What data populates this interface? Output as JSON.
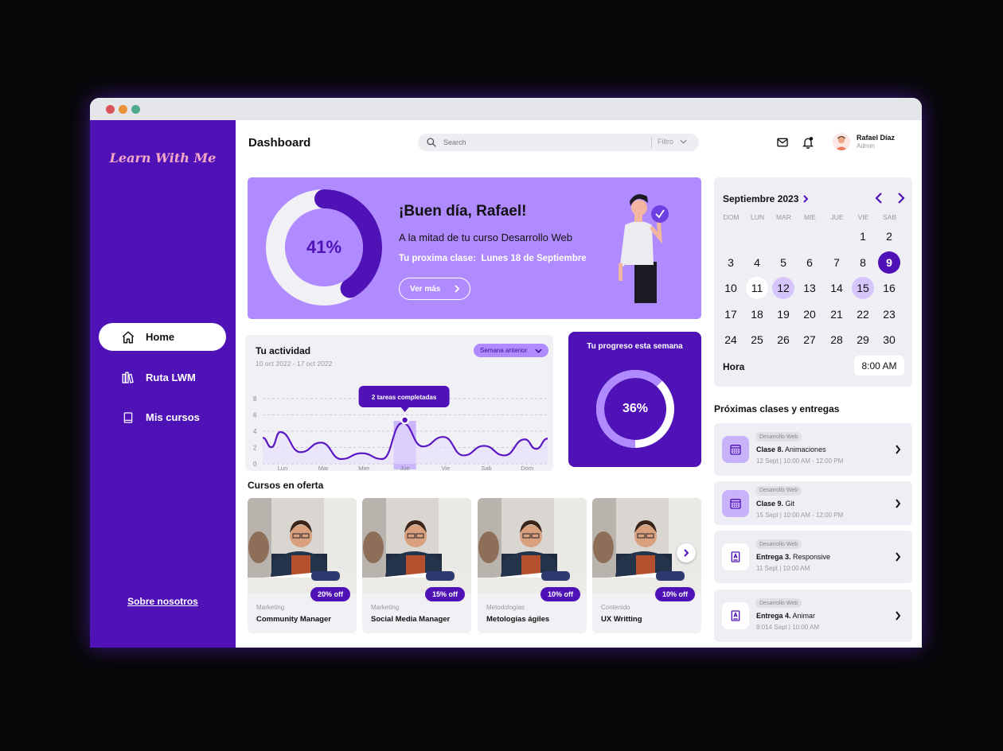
{
  "brand": "Learn With Me",
  "sidebar": {
    "items": [
      {
        "label": "Home",
        "icon": "home-icon",
        "active": true
      },
      {
        "label": "Ruta LWM",
        "icon": "library-icon",
        "active": false
      },
      {
        "label": "Mis cursos",
        "icon": "book-icon",
        "active": false
      }
    ],
    "about": "Sobre nosotros"
  },
  "header": {
    "title": "Dashboard",
    "search_placeholder": "Search",
    "filter_label": "Filtro",
    "user_name": "Rafael Díaz",
    "user_role": "Admin"
  },
  "banner": {
    "progress_pct": 41,
    "progress_label": "41%",
    "greeting": "¡Buen día, Rafael!",
    "subtitle": "A la mitad de tu curso Desarrollo Web",
    "next_class_label": "Tu proxima clase:",
    "next_class_date": "Lunes 18 de Septiembre",
    "cta": "Ver más"
  },
  "activity": {
    "title": "Tu actividad",
    "range": "10 oct 2022 - 17 oct 2022",
    "week_select": "Semana anterior",
    "tooltip": "2 tareas completadas",
    "y_ticks": [
      "8",
      "6",
      "4",
      "2",
      "0"
    ],
    "days": [
      "Lun",
      "Mar",
      "Mier",
      "Jue",
      "Vie",
      "Sab",
      "Dom"
    ]
  },
  "chart_data": {
    "type": "line",
    "title": "Tu actividad",
    "categories": [
      "Lun",
      "Mar",
      "Mier",
      "Jue",
      "Vie",
      "Sab",
      "Dom"
    ],
    "values": [
      3.9,
      2.6,
      1.3,
      5.0,
      3.3,
      2.2,
      3.0
    ],
    "ylim": [
      0,
      8
    ],
    "highlight": {
      "category": "Jue",
      "value": 5,
      "label": "2 tareas completadas"
    },
    "grid": true
  },
  "weekly_progress": {
    "title": "Tu progreso esta semana",
    "pct": 36,
    "label": "36%"
  },
  "offers": {
    "title": "Cursos en oferta",
    "courses": [
      {
        "discount": "20% off",
        "category": "Marketing",
        "name": "Community Manager"
      },
      {
        "discount": "15% off",
        "category": "Marketing",
        "name": "Social Media Manager"
      },
      {
        "discount": "10% off",
        "category": "Metodologías",
        "name": "Metologías ágiles"
      },
      {
        "discount": "10% off",
        "category": "Contenido",
        "name": "UX Writting"
      }
    ]
  },
  "calendar": {
    "month": "Septiembre 2023",
    "weekdays": [
      "DOM",
      "LUN",
      "MAR",
      "MIE",
      "JUE",
      "VIE",
      "SAB"
    ],
    "first_weekday": 5,
    "days_in_month": 30,
    "selected_day": 9,
    "highlighted_days": [
      12,
      15
    ],
    "white_days": [
      11
    ],
    "hora_label": "Hora",
    "hora_value": "8:00 AM"
  },
  "upcoming": {
    "title": "Próximas clases y entregas",
    "items": [
      {
        "tag": "Desarrollo Web",
        "kind": "Clase 8.",
        "name": "Animaciones",
        "date": "12 Sept | 10:00 AM - 12:00 PM",
        "icon": "calendar-icon"
      },
      {
        "tag": "Desarrollo Web",
        "kind": "Clase 9.",
        "name": "Git",
        "date": "15 Sept | 10:00 AM - 12:00 PM",
        "icon": "calendar-icon"
      },
      {
        "tag": "Desarrollo Web",
        "kind": "Entrega 3.",
        "name": "Responsive",
        "date": "11 Sept | 10:00 AM",
        "icon": "document-icon"
      },
      {
        "tag": "Desarrollo Web",
        "kind": "Entrega 4.",
        "name": "Animar",
        "date": "8:014 Sept | 10:00 AM",
        "icon": "document-icon"
      }
    ]
  },
  "colors": {
    "primary": "#4f12b6",
    "light_purple": "#b08bff",
    "pale_purple": "#d5c5fb",
    "brand_text": "#f4a7c7"
  }
}
